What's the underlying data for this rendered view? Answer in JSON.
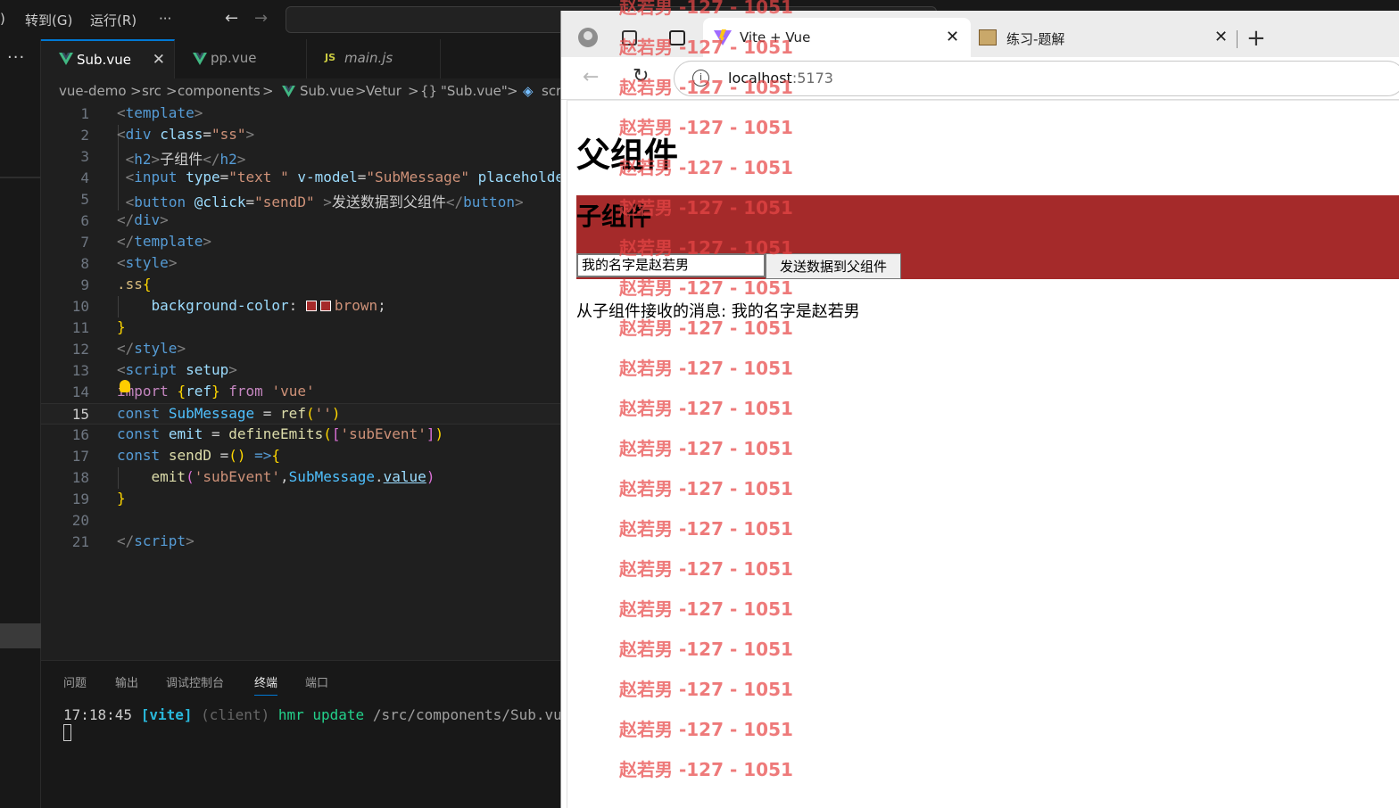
{
  "menubar": {
    "partial_label": ")",
    "goto": "转到(G)",
    "run": "运行(R)",
    "more": "···",
    "back_icon": "arrow-left-icon",
    "forward_icon": "arrow-right-icon"
  },
  "activity": {
    "more": "···"
  },
  "editor_tabs": [
    {
      "label": "Sub.vue",
      "icon": "vue-icon",
      "active": true
    },
    {
      "label": "pp.vue",
      "icon": "vue-icon",
      "active": false
    },
    {
      "label": "main.js",
      "icon": "js-icon",
      "icon_text": "JS",
      "active": false
    }
  ],
  "breadcrumb": {
    "parts": [
      "vue-demo",
      ">",
      "src",
      ">",
      "components",
      ">",
      "Sub.vue",
      ">",
      "Vetur",
      ">",
      "{}",
      "\"Sub.vue\"",
      ">",
      "scr"
    ]
  },
  "code_lines": [
    "1",
    "2",
    "3",
    "4",
    "5",
    "6",
    "7",
    "8",
    "9",
    "10",
    "11",
    "12",
    "13",
    "14",
    "15",
    "16",
    "17",
    "18",
    "19",
    "20",
    "21"
  ],
  "code": {
    "l1": "template",
    "l2_tag": "div",
    "l2_attr": "class",
    "l2_val": "\"ss\"",
    "l3_tag": "h2",
    "l3_text": "子组件",
    "l4_tag": "input",
    "l4_attr1": "type",
    "l4_val1": "\"text \"",
    "l4_attr2": "v-model",
    "l4_val2": "\"SubMessage\"",
    "l4_attr3": "placeholde",
    "l5_tag": "button",
    "l5_attr": "@click",
    "l5_val": "\"sendD\"",
    "l5_text": "发送数据到父组件",
    "l6_tag": "div",
    "l7_tag": "template",
    "l8_tag": "style",
    "l9_sel": ".ss",
    "l10_prop": "background-color",
    "l10_val": "brown",
    "l12_tag": "style",
    "l13_tag": "script",
    "l13_attr": "setup",
    "l14_kw": "import",
    "l14_ref": "ref",
    "l14_from": "from",
    "l14_str": "'vue'",
    "l15_kw": "const",
    "l15_var": "SubMessage",
    "l15_fn": "ref",
    "l15_str": "''",
    "l16_kw": "const",
    "l16_var": "emit",
    "l16_fn": "defineEmits",
    "l16_str": "'subEvent'",
    "l17_kw": "const",
    "l17_var": "sendD",
    "l18_fn": "emit",
    "l18_str": "'subEvent'",
    "l18_var": "SubMessage",
    "l18_prop": "value",
    "l21_tag": "script"
  },
  "panel": {
    "tabs": [
      "问题",
      "输出",
      "调试控制台",
      "终端",
      "端口"
    ],
    "active_tab": "终端",
    "terminal": {
      "time": "17:18:45",
      "tag": "[vite]",
      "client": "(client)",
      "msg": "hmr update",
      "path": "/src/components/Sub.vue"
    }
  },
  "browser": {
    "tabs": [
      {
        "title": "Vite + Vue",
        "icon": "vite-icon",
        "active": true
      },
      {
        "title": "练习-题解",
        "icon": "site-favicon",
        "active": false
      }
    ],
    "new_tab": "+",
    "url_host": "localhost",
    "url_port": ":5173",
    "info_icon": "i"
  },
  "page": {
    "parent_title": "父组件",
    "child_title": "子组件",
    "input_value": "我的名字是赵若男",
    "button_label": "发送数据到父组件",
    "received_text": "从子组件接收的消息: 我的名字是赵若男"
  },
  "watermark": {
    "text": "赵若男 -127 - 1051"
  },
  "colors": {
    "accent": "#0078d4",
    "child_bg": "#a52a2a",
    "watermark": "#e84646",
    "vue_green": "#41b883"
  }
}
